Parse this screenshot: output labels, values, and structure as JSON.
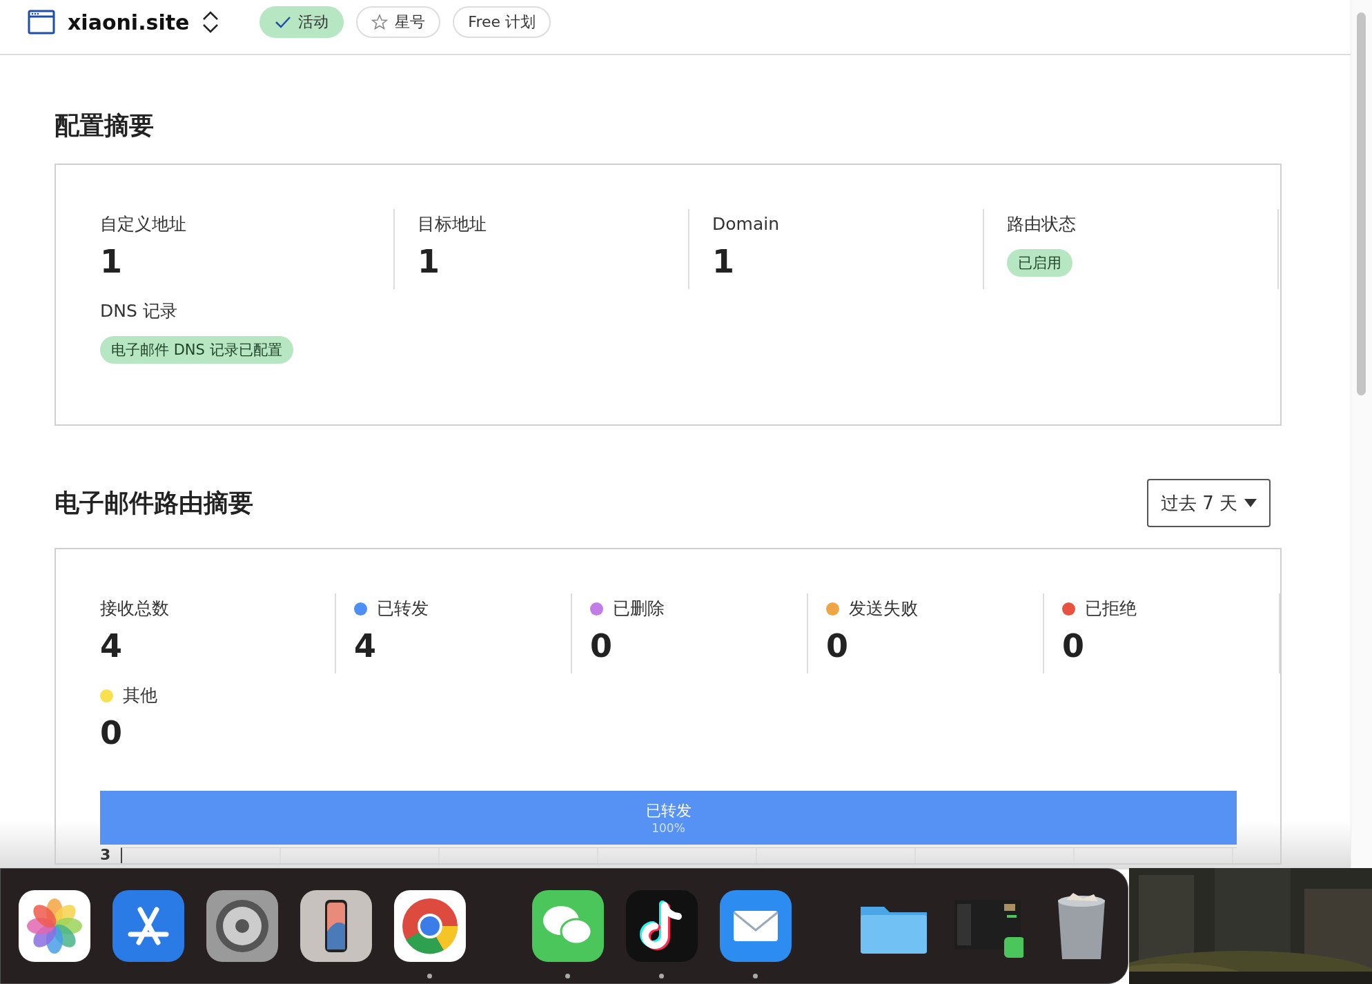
{
  "header": {
    "site": "xiaoni.site",
    "badges": [
      {
        "label": "活动",
        "kind": "active"
      },
      {
        "label": "星号",
        "kind": "star"
      },
      {
        "label": "Free 计划",
        "kind": "plain"
      }
    ]
  },
  "config_summary": {
    "title": "配置摘要",
    "stats": [
      {
        "label": "自定义地址",
        "value": "1"
      },
      {
        "label": "目标地址",
        "value": "1"
      },
      {
        "label": "Domain",
        "value": "1"
      },
      {
        "label": "路由状态",
        "status": "已启用"
      }
    ],
    "dns": {
      "label": "DNS 记录",
      "status": "电子邮件 DNS 记录已配置"
    }
  },
  "routing_summary": {
    "title": "电子邮件路由摘要",
    "range": "过去 7 天",
    "stats": [
      {
        "label": "接收总数",
        "value": "4"
      },
      {
        "label": "已转发",
        "value": "4",
        "color": "#4f8ef6"
      },
      {
        "label": "已删除",
        "value": "0",
        "color": "#c17de6"
      },
      {
        "label": "发送失败",
        "value": "0",
        "color": "#f0a545"
      },
      {
        "label": "已拒绝",
        "value": "0",
        "color": "#e8533f"
      },
      {
        "label": "其他",
        "value": "0",
        "color": "#f8e04f"
      }
    ],
    "distribution": [
      {
        "label": "已转发",
        "percent": "100%",
        "level": 1,
        "color": "#5592f4"
      }
    ],
    "axis_tick": "3"
  },
  "dock": {
    "groups": [
      [
        {
          "kind": "photos",
          "running": false
        },
        {
          "kind": "appstore",
          "running": false
        },
        {
          "kind": "settings",
          "running": false
        },
        {
          "kind": "phone",
          "running": false
        },
        {
          "kind": "chrome",
          "running": true
        }
      ],
      [
        {
          "kind": "wechat",
          "running": true
        },
        {
          "kind": "tiktok",
          "running": true
        },
        {
          "kind": "mail",
          "running": true
        }
      ],
      [
        {
          "kind": "folder",
          "running": false
        },
        {
          "kind": "window",
          "running": false
        },
        {
          "kind": "trash",
          "running": false
        }
      ]
    ]
  }
}
